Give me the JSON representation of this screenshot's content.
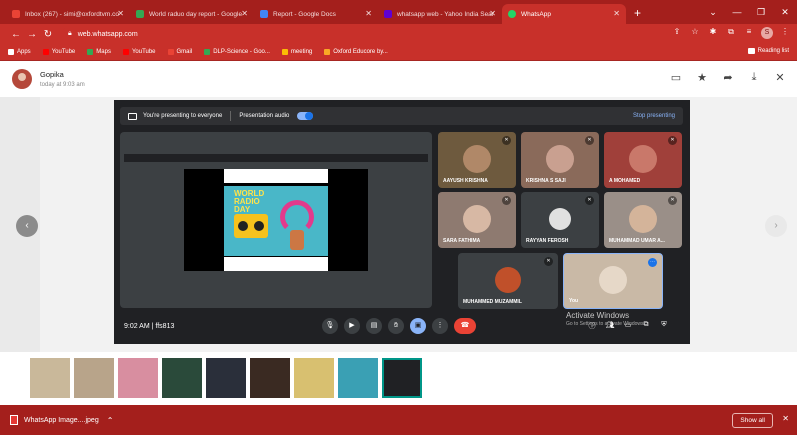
{
  "browser": {
    "tabs": [
      {
        "label": "Inbox (267) - simi@oxfordtvm.co",
        "favicon_color": "#ea4335"
      },
      {
        "label": "World raduo day report - Google",
        "favicon_color": "#34a853"
      },
      {
        "label": "Report - Google Docs",
        "favicon_color": "#4285f4"
      },
      {
        "label": "whatsapp web - Yahoo India Sear",
        "favicon_color": "#6001d2"
      },
      {
        "label": "WhatsApp",
        "favicon_color": "#25d366"
      }
    ],
    "url": "web.whatsapp.com",
    "profile_initial": "S",
    "bookmarks": [
      {
        "label": "Apps",
        "color": "#ffffff"
      },
      {
        "label": "YouTube",
        "color": "#ff0000"
      },
      {
        "label": "Maps",
        "color": "#34a853"
      },
      {
        "label": "YouTube",
        "color": "#ff0000"
      },
      {
        "label": "Gmail",
        "color": "#ea4335"
      },
      {
        "label": "DLP-Science - Goo...",
        "color": "#34a853"
      },
      {
        "label": "meeting",
        "color": "#fbbc05"
      },
      {
        "label": "Oxford Educore by...",
        "color": "#f9a825"
      }
    ],
    "reading_list": "Reading list"
  },
  "media_viewer": {
    "sender": "Gopika",
    "time": "today at 9:03 am"
  },
  "meet": {
    "presenting_text": "You're presenting to everyone",
    "audio_label": "Presentation audio",
    "stop_label": "Stop presenting",
    "slide_title": "WORLD RADIO DAY",
    "clock": "9:02 AM",
    "meeting_code": "ffs813",
    "participants": [
      {
        "name": "AAYUSH KRISHNA",
        "bg": "#6e5a3e"
      },
      {
        "name": "KRISHNA S SAJI",
        "bg": "#8a6a5a"
      },
      {
        "name": "A MOHAMED",
        "bg": "#a0403a"
      },
      {
        "name": "SARA FATHIMA",
        "bg": "#8e7a70"
      },
      {
        "name": "RAYYAN FEROSH",
        "bg": "#3c4043"
      },
      {
        "name": "MUHAMMAD UMAR A...",
        "bg": "#9a8f88"
      },
      {
        "name": "MUHAMMED MUZAMMIL",
        "bg": "#3c4043"
      },
      {
        "name": "You",
        "bg": "#c9b9a6"
      }
    ]
  },
  "watermark": {
    "title": "Activate Windows",
    "subtitle": "Go to Settings to activate Windows."
  },
  "thumbnails": [
    {
      "color": "#c9b89a"
    },
    {
      "color": "#b8a48a"
    },
    {
      "color": "#d88ea0"
    },
    {
      "color": "#2a4a3a"
    },
    {
      "color": "#2a2f3a"
    },
    {
      "color": "#3a2a22"
    },
    {
      "color": "#d8c070"
    },
    {
      "color": "#3aa0b4"
    },
    {
      "color": "#202124"
    }
  ],
  "download": {
    "filename": "WhatsApp Image....jpeg",
    "show_all": "Show all"
  }
}
